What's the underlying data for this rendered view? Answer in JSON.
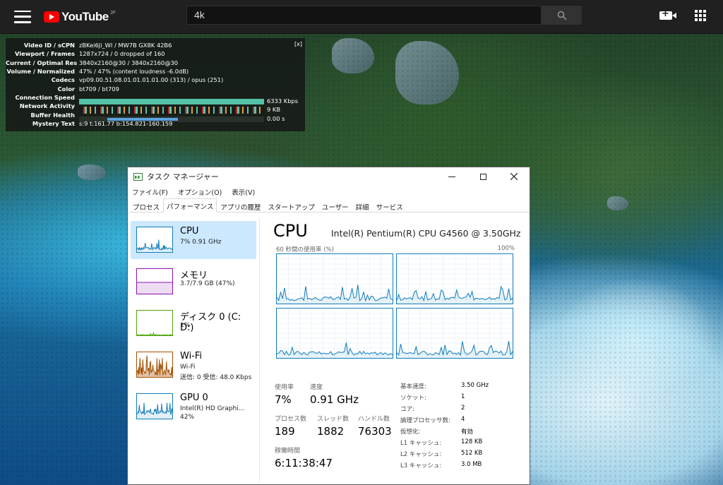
{
  "youtube": {
    "logo_text": "YouTube",
    "logo_region": "JP",
    "search_value": "4k"
  },
  "stats_for_nerds": {
    "close_label": "[x]",
    "rows": [
      {
        "key": "Video ID / sCPN",
        "value": "zBKei6Ji_WI / MW7B GX8K 42B6"
      },
      {
        "key": "Viewport / Frames",
        "value": "1287x724 / 0 dropped of 160"
      },
      {
        "key": "Current / Optimal Res",
        "value": "3840x2160@30 / 3840x2160@30"
      },
      {
        "key": "Volume / Normalized",
        "value": "47% / 47% (content loudness -6.0dB)"
      },
      {
        "key": "Codecs",
        "value": "vp09.00.51.08.01.01.01.01.00 (313) / opus (251)"
      },
      {
        "key": "Color",
        "value": "bt709 / bt709"
      },
      {
        "key": "Connection Speed",
        "value": "6333 Kbps"
      },
      {
        "key": "Network Activity",
        "value": "9 KB"
      },
      {
        "key": "Buffer Health",
        "value": "0.00 s"
      },
      {
        "key": "Mystery Text",
        "value": "s:9 t:161.77 b:154.821-160.159"
      }
    ],
    "connection_speed_fraction": 1.0
  },
  "task_manager": {
    "title": "タスク マネージャー",
    "menu": [
      "ファイル(F)",
      "オプション(O)",
      "表示(V)"
    ],
    "tabs": [
      "プロセス",
      "パフォーマンス",
      "アプリの履歴",
      "スタートアップ",
      "ユーザー",
      "詳細",
      "サービス"
    ],
    "active_tab": "パフォーマンス",
    "sidebar": [
      {
        "name": "CPU",
        "sub": "7%  0.91 GHz",
        "sub2": "",
        "color": "#117dbb"
      },
      {
        "name": "メモリ",
        "sub": "3.7/7.9 GB (47%)",
        "sub2": "",
        "color": "#8b12ae"
      },
      {
        "name": "ディスク 0 (C: D:)",
        "sub": "1%",
        "sub2": "",
        "color": "#4da60c"
      },
      {
        "name": "Wi-Fi",
        "sub": "Wi-Fi",
        "sub2": "送信: 0 受信: 48.0 Kbps",
        "color": "#a74f01"
      },
      {
        "name": "GPU 0",
        "sub": "Intel(R) HD Graphi...",
        "sub2": "42%",
        "color": "#117dbb"
      }
    ],
    "main": {
      "title": "CPU",
      "cpu_name": "Intel(R) Pentium(R) CPU G4560 @ 3.50GHz",
      "graph_label_left": "60 秒間の使用率 (%)",
      "graph_label_right": "100%",
      "utilization_label": "使用率",
      "utilization": "7%",
      "speed_label": "速度",
      "speed": "0.91 GHz",
      "processes_label": "プロセス数",
      "processes": "189",
      "threads_label": "スレッド数",
      "threads": "1882",
      "handles_label": "ハンドル数",
      "handles": "76303",
      "uptime_label": "稼働時間",
      "uptime": "6:11:38:47",
      "info": [
        {
          "key": "基本速度:",
          "value": "3.50 GHz"
        },
        {
          "key": "ソケット:",
          "value": "1"
        },
        {
          "key": "コア:",
          "value": "2"
        },
        {
          "key": "論理プロセッサ数:",
          "value": "4"
        },
        {
          "key": "仮想化:",
          "value": "有効"
        },
        {
          "key": "L1 キャッシュ:",
          "value": "128 KB"
        },
        {
          "key": "L2 キャッシュ:",
          "value": "512 KB"
        },
        {
          "key": "L3 キャッシュ:",
          "value": "3.0 MB"
        }
      ]
    }
  }
}
